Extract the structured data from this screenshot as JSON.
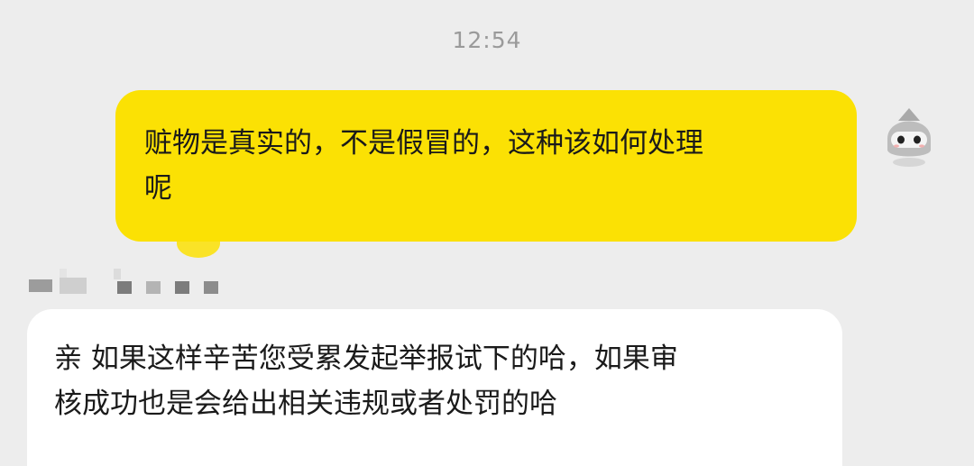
{
  "chat": {
    "timestamp": "12:54",
    "messages": [
      {
        "direction": "outgoing",
        "bubble_color": "#fbe104",
        "lines": [
          "赃物是真实的，不是假冒的，这种该如何处理",
          "呢"
        ]
      },
      {
        "direction": "incoming",
        "bubble_color": "#ffffff",
        "lines": [
          "亲  如果这样辛苦您受累发起举报试下的哈，如果审",
          "核成功也是会给出相关违规或者处罚的哈"
        ]
      }
    ],
    "sender_avatar_icon": "masked-character-avatar-icon"
  }
}
